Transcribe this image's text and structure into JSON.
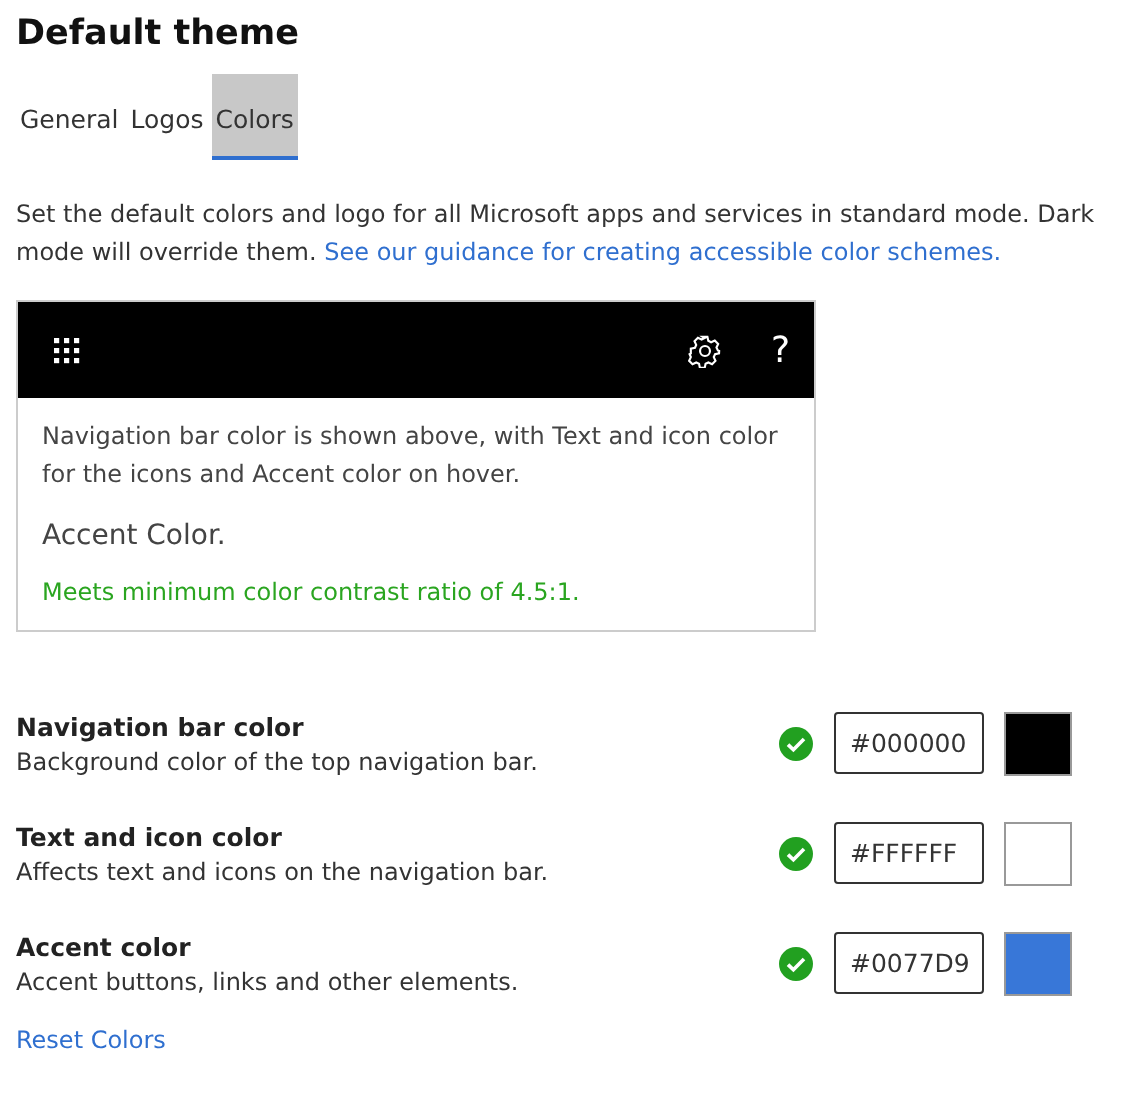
{
  "title": "Default theme",
  "tabs": [
    {
      "label": "General",
      "selected": false
    },
    {
      "label": "Logos",
      "selected": false
    },
    {
      "label": "Colors",
      "selected": true
    }
  ],
  "description": {
    "text": "Set the default colors and logo for all Microsoft apps and services in standard mode. Dark mode will override them.",
    "link": "See our guidance for creating accessible color schemes."
  },
  "preview": {
    "help_glyph": "?",
    "text": "Navigation bar color is shown above, with Text and icon color for the icons and Accent color on hover.",
    "accent_label": "Accent Color.",
    "contrast_message": "Meets minimum color contrast ratio of 4.5:1."
  },
  "color_settings": [
    {
      "label": "Navigation bar color",
      "hint": "Background color of the top navigation bar.",
      "value": "#000000",
      "valid": true,
      "color": "#000000"
    },
    {
      "label": "Text and icon color",
      "hint": "Affects text and icons on the navigation bar.",
      "value": "#FFFFFF",
      "valid": true,
      "color": "#ffffff"
    },
    {
      "label": "Accent color",
      "hint": "Accent buttons, links and other elements.",
      "value": "#0077D9",
      "valid": true,
      "color": "#3877d8"
    }
  ],
  "reset_link": "Reset Colors"
}
